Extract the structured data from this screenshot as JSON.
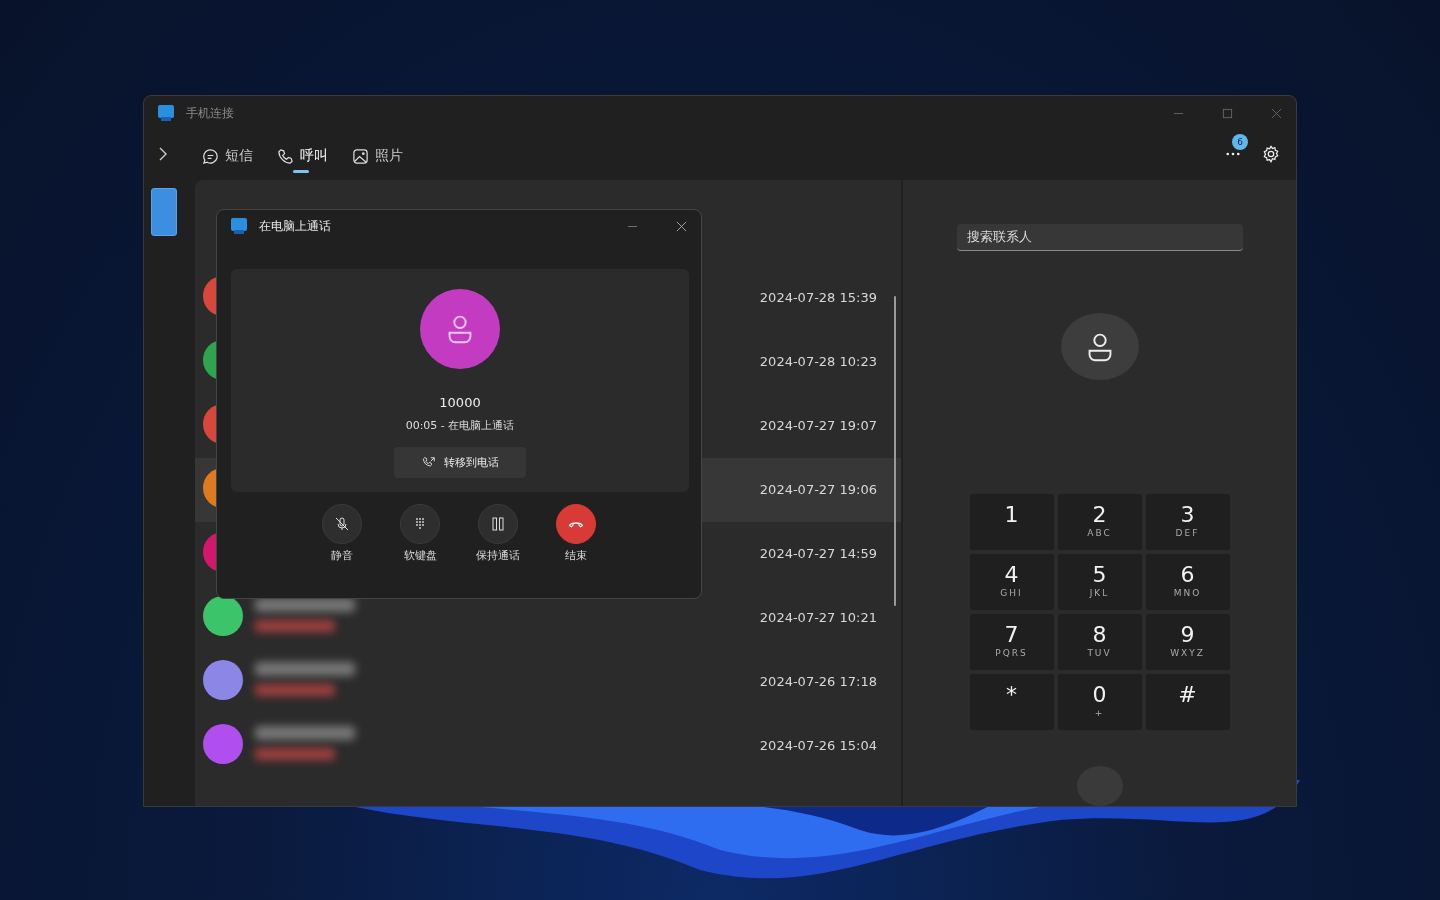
{
  "window": {
    "title": "手机连接"
  },
  "nav": {
    "tabs": [
      {
        "label": "短信",
        "selected": false
      },
      {
        "label": "呼叫",
        "selected": true
      },
      {
        "label": "照片",
        "selected": false
      }
    ],
    "more_badge": "6"
  },
  "call_log": [
    {
      "time": "2024-07-28 15:39",
      "color": "#d9463b",
      "selected": false
    },
    {
      "time": "2024-07-28 10:23",
      "color": "#2fa44f",
      "selected": false
    },
    {
      "time": "2024-07-27 19:07",
      "color": "#d9463b",
      "selected": false
    },
    {
      "time": "2024-07-27 19:06",
      "color": "#e07a1f",
      "selected": true
    },
    {
      "time": "2024-07-27 14:59",
      "color": "#d3176c",
      "selected": false
    },
    {
      "time": "2024-07-27 10:21",
      "color": "#3cc46a",
      "selected": false
    },
    {
      "time": "2024-07-26 17:18",
      "color": "#8c86e6",
      "selected": false
    },
    {
      "time": "2024-07-26 15:04",
      "color": "#b14ef0",
      "selected": false
    }
  ],
  "dialer": {
    "search": {
      "placeholder": "搜索联系人"
    },
    "keys": [
      {
        "digit": "1"
      },
      {
        "digit": "2",
        "letters": "ABC"
      },
      {
        "digit": "3",
        "letters": "DEF"
      },
      {
        "digit": "4",
        "letters": "GHI"
      },
      {
        "digit": "5",
        "letters": "JKL"
      },
      {
        "digit": "6",
        "letters": "MNO"
      },
      {
        "digit": "7",
        "letters": "PQRS"
      },
      {
        "digit": "8",
        "letters": "TUV"
      },
      {
        "digit": "9",
        "letters": "WXYZ"
      },
      {
        "digit": "*"
      },
      {
        "digit": "0",
        "letters": "+"
      },
      {
        "digit": "#"
      }
    ]
  },
  "call_popup": {
    "title": "在电脑上通话",
    "number": "10000",
    "status": "00:05 - 在电脑上通话",
    "transfer_button": "转移到电话",
    "actions": [
      {
        "label": "静音",
        "kind": "mute"
      },
      {
        "label": "软键盘",
        "kind": "keypad"
      },
      {
        "label": "保持通话",
        "kind": "hold"
      },
      {
        "label": "结束",
        "kind": "end"
      }
    ]
  }
}
